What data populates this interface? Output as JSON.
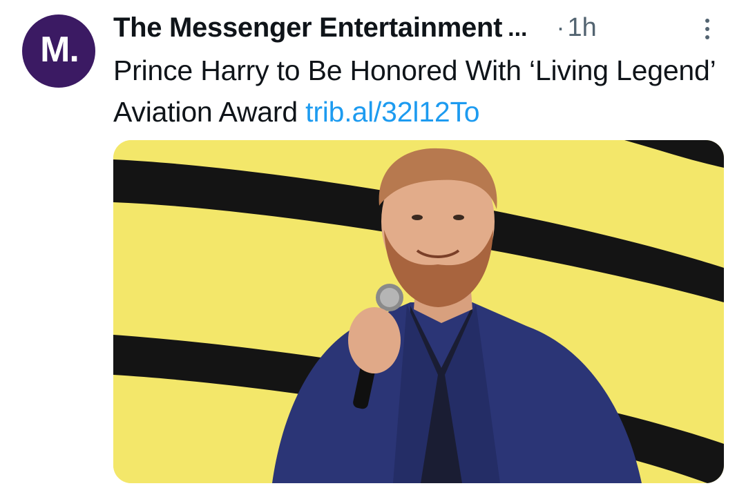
{
  "tweet": {
    "avatar_text": "M.",
    "author_name": "The Messenger Entertainment",
    "author_ellipsis": "...",
    "time_separator": "·",
    "time": "1h",
    "text": "Prince Harry to Be Honored With ‘Living Legend’ Aviation Award ",
    "link_text": "trib.al/32l12To",
    "more_icon": "more-vertical-icon",
    "photo_icon": "photo-of-man-speaking-at-microphone"
  },
  "colors": {
    "avatar_bg": "#3b1a63",
    "link": "#1d9bf0",
    "secondary_text": "#536471",
    "primary_text": "#0f1419",
    "photo_yellow": "#f3e76a",
    "photo_stripe": "#141414",
    "suit": "#2b3576"
  }
}
